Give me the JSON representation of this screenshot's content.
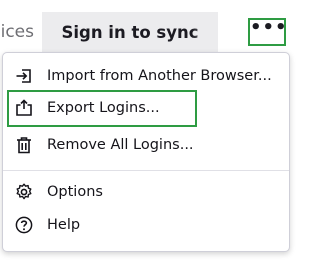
{
  "toolbar": {
    "partial_tab_label": "ices",
    "sync_tab_label": "Sign in to sync",
    "more_button_label": "•••"
  },
  "menu": {
    "items": [
      {
        "label": "Import from Another Browser...",
        "icon": "import-icon"
      },
      {
        "label": "Export Logins...",
        "icon": "export-icon"
      },
      {
        "label": "Remove All Logins...",
        "icon": "trash-icon"
      },
      {
        "label": "Options",
        "icon": "gear-icon"
      },
      {
        "label": "Help",
        "icon": "help-icon"
      }
    ]
  },
  "colors": {
    "highlight_outline": "#2e9c43",
    "tab_background": "#ececee",
    "text": "#15141a"
  }
}
